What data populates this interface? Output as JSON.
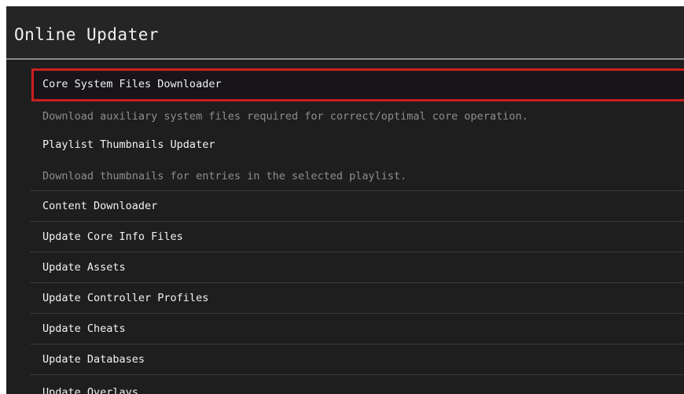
{
  "header": {
    "title": "Online Updater"
  },
  "colors": {
    "background": "#1e1e1e",
    "header_background": "#252525",
    "selection_border": "#cc1f1f",
    "text": "#f2f2f2",
    "sublabel_text": "#8e8e8e"
  },
  "menu": {
    "items": [
      {
        "label": "Core System Files Downloader",
        "sublabel": "Download auxiliary system files required for correct/optimal core operation.",
        "selected": true
      },
      {
        "label": "Playlist Thumbnails Updater",
        "sublabel": "Download thumbnails for entries in the selected playlist."
      },
      {
        "label": "Content Downloader"
      },
      {
        "label": "Update Core Info Files"
      },
      {
        "label": "Update Assets"
      },
      {
        "label": "Update Controller Profiles"
      },
      {
        "label": "Update Cheats"
      },
      {
        "label": "Update Databases"
      },
      {
        "label": "Update Overlays"
      }
    ]
  }
}
